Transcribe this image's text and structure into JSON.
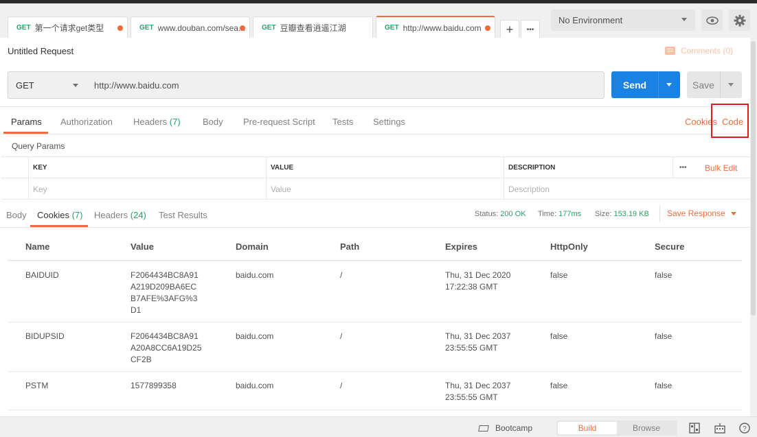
{
  "tabs": [
    {
      "method": "GET",
      "title": "第一个请求get类型"
    },
    {
      "method": "GET",
      "title": "www.douban.com/sea..."
    },
    {
      "method": "GET",
      "title": "豆瓣查看逍遥江湖"
    },
    {
      "method": "GET",
      "title": "http://www.baidu.com"
    }
  ],
  "tab_controls": {
    "add": "+",
    "more": "•••"
  },
  "environment": {
    "selected": "No Environment"
  },
  "request": {
    "title": "Untitled Request",
    "comments": "Comments (0)",
    "method": "GET",
    "url": "http://www.baidu.com",
    "send": "Send",
    "save": "Save"
  },
  "request_tabs": [
    {
      "label": "Params",
      "count": ""
    },
    {
      "label": "Authorization",
      "count": ""
    },
    {
      "label": "Headers",
      "count": "(7)"
    },
    {
      "label": "Body",
      "count": ""
    },
    {
      "label": "Pre-request Script",
      "count": ""
    },
    {
      "label": "Tests",
      "count": ""
    },
    {
      "label": "Settings",
      "count": ""
    }
  ],
  "request_links": {
    "cookies": "Cookies",
    "code": "Code"
  },
  "query_params": {
    "title": "Query Params",
    "headers": [
      "KEY",
      "VALUE",
      "DESCRIPTION"
    ],
    "more": "•••",
    "bulk_edit": "Bulk Edit",
    "placeholders": [
      "Key",
      "Value",
      "Description"
    ]
  },
  "response_tabs": [
    {
      "label": "Body",
      "count": ""
    },
    {
      "label": "Cookies",
      "count": "(7)"
    },
    {
      "label": "Headers",
      "count": "(24)"
    },
    {
      "label": "Test Results",
      "count": ""
    }
  ],
  "response_meta": {
    "status_label": "Status:",
    "status": "200 OK",
    "time_label": "Time:",
    "time": "177ms",
    "size_label": "Size:",
    "size": "153.19 KB",
    "save_response": "Save Response"
  },
  "cookies": {
    "columns": [
      "Name",
      "Value",
      "Domain",
      "Path",
      "Expires",
      "HttpOnly",
      "Secure"
    ],
    "rows": [
      {
        "name": "BAIDUID",
        "value": "F2064434BC8A91A219D209BA6ECB7AFE%3AFG%3D1",
        "domain": "baidu.com",
        "path": "/",
        "expires": "Thu, 31 Dec 2020 17:22:38 GMT",
        "httponly": "false",
        "secure": "false"
      },
      {
        "name": "BIDUPSID",
        "value": "F2064434BC8A91A20A8CC6A19D25CF2B",
        "domain": "baidu.com",
        "path": "/",
        "expires": "Thu, 31 Dec 2037 23:55:55 GMT",
        "httponly": "false",
        "secure": "false"
      },
      {
        "name": "PSTM",
        "value": "1577899358",
        "domain": "baidu.com",
        "path": "/",
        "expires": "Thu, 31 Dec 2037 23:55:55 GMT",
        "httponly": "false",
        "secure": "false"
      }
    ]
  },
  "footer": {
    "bootcamp": "Bootcamp",
    "build": "Build",
    "browse": "Browse",
    "help": "?"
  },
  "colors": {
    "accent": "#f26b3a",
    "send": "#1a82e2",
    "success": "#26a26b",
    "highlight": "#e6161c"
  }
}
